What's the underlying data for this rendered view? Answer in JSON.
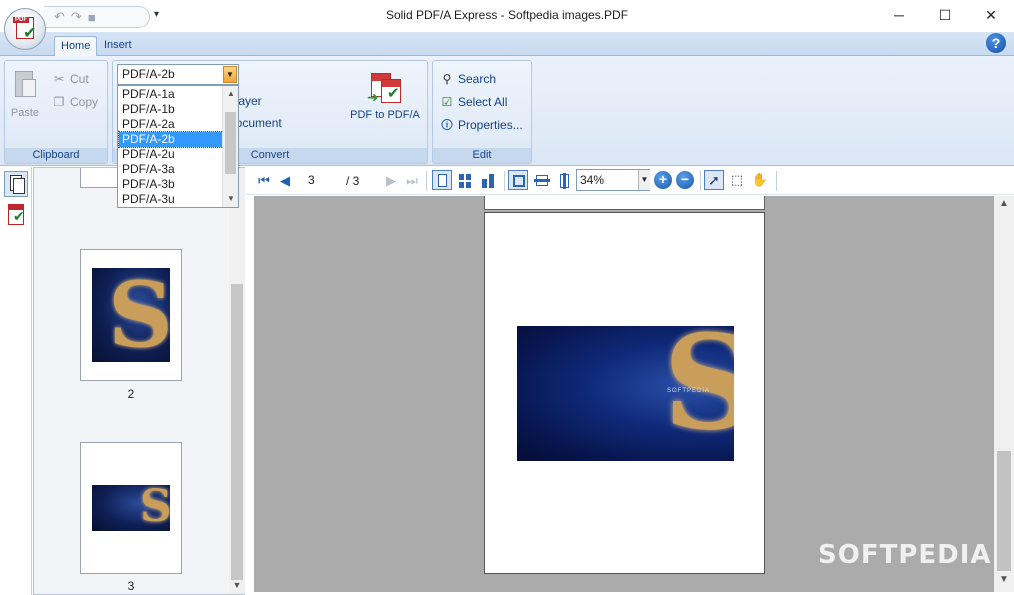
{
  "window": {
    "title": "Solid PDF/A Express - Softpedia images.PDF",
    "minimize_glyph": "─",
    "maximize_glyph": "☐",
    "close_glyph": "✕"
  },
  "app_orb": {
    "badge": "PDF"
  },
  "quick_access": {
    "undo_glyph": "↶",
    "redo_glyph": "↷",
    "save_glyph": "■",
    "more_glyph": "▾"
  },
  "ribbon": {
    "tabs": [
      {
        "label": "Home",
        "active": true
      },
      {
        "label": "Insert",
        "active": false
      }
    ],
    "help_glyph": "?",
    "groups": {
      "clipboard": {
        "label": "Clipboard",
        "paste": "Paste",
        "cut": "Cut",
        "copy": "Copy"
      },
      "convert": {
        "label": "Convert",
        "partial_item_1": "t layer",
        "partial_item_2": "document",
        "pdf_to_pdfa": "PDF to PDF/A",
        "launcher_glyph": "⬊"
      },
      "edit": {
        "label": "Edit",
        "search": "Search",
        "select_all": "Select All",
        "properties": "Properties..."
      }
    }
  },
  "pdfa_dropdown": {
    "selected": "PDF/A-2b",
    "options": [
      "PDF/A-1a",
      "PDF/A-1b",
      "PDF/A-2a",
      "PDF/A-2b",
      "PDF/A-2u",
      "PDF/A-3a",
      "PDF/A-3b",
      "PDF/A-3u"
    ],
    "selected_index": 3
  },
  "thumbnails": {
    "pages": [
      {
        "label": "2"
      },
      {
        "label": "3"
      }
    ],
    "art_letter": "S"
  },
  "viewer_toolbar": {
    "first_glyph": "⏮",
    "prev_glyph": "◀",
    "next_glyph": "▶",
    "last_glyph": "⏭",
    "current_page": "3",
    "total_pages": "/ 3",
    "zoom": "34%",
    "zoom_in_glyph": "+",
    "zoom_out_glyph": "−"
  },
  "document": {
    "image_letter": "S",
    "image_caption": "SOFTPEDIA"
  },
  "watermark": "SOFTPEDIA",
  "colors": {
    "ribbon_blue": "#dbe7f6",
    "ribbon_text": "#15428b",
    "selection": "#3399ff",
    "viewer_bg": "#ababab"
  }
}
